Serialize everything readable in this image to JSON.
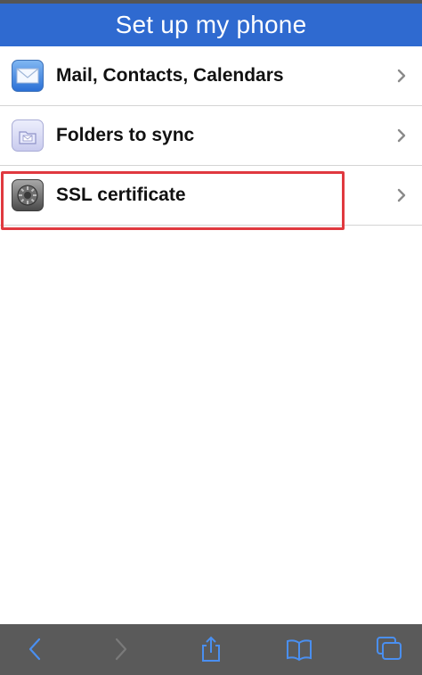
{
  "header": {
    "title": "Set up my phone"
  },
  "list": {
    "items": [
      {
        "label": "Mail, Contacts, Calendars",
        "icon": "mail-icon"
      },
      {
        "label": "Folders to sync",
        "icon": "folder-icon"
      },
      {
        "label": "SSL certificate",
        "icon": "settings-gear-icon"
      }
    ]
  },
  "toolbar": {
    "icons": [
      "back-arrow-icon",
      "forward-arrow-icon",
      "share-icon",
      "bookmarks-icon",
      "tabs-icon"
    ]
  },
  "colors": {
    "header_bg": "#2f6ad0",
    "highlight": "#e0393f",
    "toolbar_bg": "#5a5a5a",
    "toolbar_icon": "#4a8ff0"
  }
}
